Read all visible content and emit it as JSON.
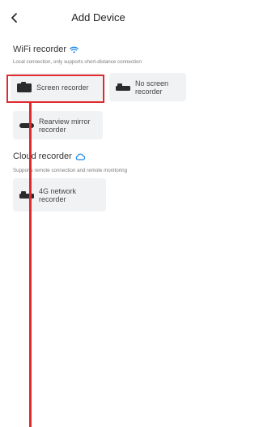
{
  "header": {
    "title": "Add Device"
  },
  "wifi_section": {
    "title": "WiFi recorder",
    "subtitle": "Local connection, only supports short-distance connection",
    "devices": [
      {
        "label": "Screen recorder",
        "icon": "dashcam-screen-icon"
      },
      {
        "label": "No screen recorder",
        "icon": "dashcam-noscreen-icon"
      },
      {
        "label": "Rearview mirror recorder",
        "icon": "rearview-mirror-icon"
      }
    ]
  },
  "cloud_section": {
    "title": "Cloud recorder",
    "subtitle": "Supports remote connection and remote monitoring",
    "devices": [
      {
        "label": "4G network recorder",
        "icon": "4g-recorder-icon"
      }
    ]
  },
  "colors": {
    "accent_blue": "#1e88e5",
    "card_bg": "#f1f2f4",
    "highlight_red": "#e02a2f"
  }
}
